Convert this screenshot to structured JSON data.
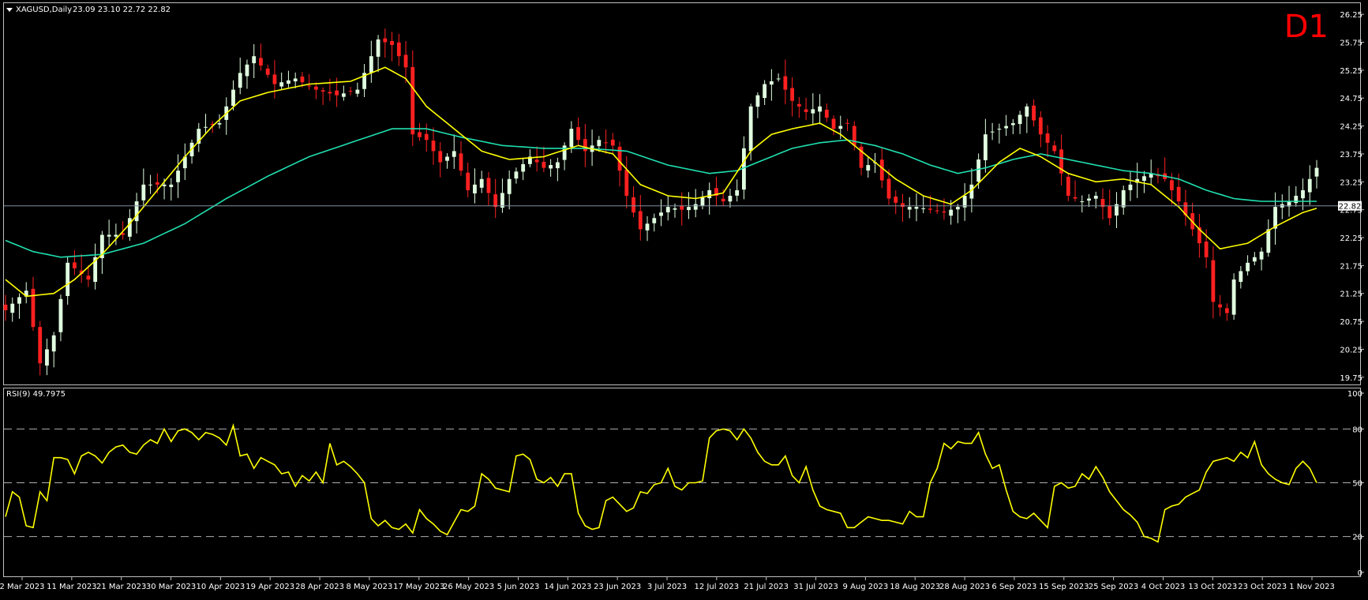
{
  "header": {
    "symbol_title": "XAGUSD,Daily",
    "ohlc_text": "23.09 23.10 22.72 22.82",
    "timeframe_badge": "D1"
  },
  "colors": {
    "background": "#000000",
    "candle_up": "#E0FFE0",
    "candle_down": "#FF2020",
    "ma_fast": "#FFFF00",
    "ma_slow": "#20E0B0",
    "rsi_line": "#FFFF00",
    "badge": "#FF0000",
    "axis_text": "#FFFFFF",
    "frame": "#C0C0C0",
    "level_line": "#8090A0"
  },
  "chart_data": [
    {
      "type": "candlestick",
      "title": "XAGUSD,Daily",
      "price_axis_ticks": [
        "26.25",
        "25.75",
        "25.25",
        "24.75",
        "24.25",
        "23.75",
        "23.25",
        "22.75",
        "22.25",
        "21.75",
        "21.25",
        "20.75",
        "20.25",
        "19.75"
      ],
      "ylim": [
        19.62,
        26.45
      ],
      "current_price_label": "22.82",
      "current_price": 22.82,
      "x_tick_labels": [
        "2 Mar 2023",
        "11 Mar 2023",
        "21 Mar 2023",
        "30 Mar 2023",
        "10 Apr 2023",
        "19 Apr 2023",
        "28 Apr 2023",
        "8 May 2023",
        "17 May 2023",
        "26 May 2023",
        "5 Jun 2023",
        "14 Jun 2023",
        "23 Jun 2023",
        "3 Jul 2023",
        "12 Jul 2023",
        "21 Jul 2023",
        "31 Jul 2023",
        "9 Aug 2023",
        "18 Aug 2023",
        "28 Aug 2023",
        "6 Sep 2023",
        "15 Sep 2023",
        "25 Sep 2023",
        "4 Oct 2023",
        "13 Oct 2023",
        "23 Oct 2023",
        "1 Nov 2023"
      ],
      "close_anchors": [
        [
          0,
          20.95
        ],
        [
          3,
          21.3
        ],
        [
          5,
          20.0
        ],
        [
          7,
          20.5
        ],
        [
          9,
          21.8
        ],
        [
          12,
          21.5
        ],
        [
          14,
          22.3
        ],
        [
          17,
          22.3
        ],
        [
          20,
          23.2
        ],
        [
          24,
          23.2
        ],
        [
          28,
          24.2
        ],
        [
          31,
          24.3
        ],
        [
          34,
          25.2
        ],
        [
          36,
          25.5
        ],
        [
          39,
          25.0
        ],
        [
          42,
          25.1
        ],
        [
          45,
          24.9
        ],
        [
          48,
          24.8
        ],
        [
          51,
          24.9
        ],
        [
          54,
          25.8
        ],
        [
          56,
          25.7
        ],
        [
          58,
          25.3
        ],
        [
          59,
          24.1
        ],
        [
          61,
          24.0
        ],
        [
          63,
          23.6
        ],
        [
          65,
          23.8
        ],
        [
          67,
          23.1
        ],
        [
          69,
          23.3
        ],
        [
          71,
          22.8
        ],
        [
          73,
          23.3
        ],
        [
          76,
          23.7
        ],
        [
          78,
          23.5
        ],
        [
          80,
          23.6
        ],
        [
          82,
          24.2
        ],
        [
          84,
          23.8
        ],
        [
          86,
          24.0
        ],
        [
          88,
          23.9
        ],
        [
          90,
          23.0
        ],
        [
          92,
          22.4
        ],
        [
          94,
          22.6
        ],
        [
          96,
          22.8
        ],
        [
          98,
          22.75
        ],
        [
          100,
          22.85
        ],
        [
          102,
          23.1
        ],
        [
          104,
          22.9
        ],
        [
          106,
          23.1
        ],
        [
          108,
          24.6
        ],
        [
          110,
          25.0
        ],
        [
          112,
          25.1
        ],
        [
          114,
          24.7
        ],
        [
          116,
          24.5
        ],
        [
          118,
          24.6
        ],
        [
          120,
          24.2
        ],
        [
          122,
          24.3
        ],
        [
          124,
          23.5
        ],
        [
          126,
          23.6
        ],
        [
          128,
          22.95
        ],
        [
          130,
          22.8
        ],
        [
          132,
          22.8
        ],
        [
          134,
          22.75
        ],
        [
          136,
          22.7
        ],
        [
          138,
          22.8
        ],
        [
          140,
          23.2
        ],
        [
          142,
          24.1
        ],
        [
          144,
          24.2
        ],
        [
          146,
          24.3
        ],
        [
          148,
          24.6
        ],
        [
          150,
          24.1
        ],
        [
          152,
          23.8
        ],
        [
          154,
          23.0
        ],
        [
          156,
          22.9
        ],
        [
          158,
          23.0
        ],
        [
          160,
          22.6
        ],
        [
          162,
          23.1
        ],
        [
          164,
          23.3
        ],
        [
          166,
          23.4
        ],
        [
          168,
          23.3
        ],
        [
          170,
          22.9
        ],
        [
          172,
          22.4
        ],
        [
          174,
          21.9
        ],
        [
          175,
          21.1
        ],
        [
          177,
          20.9
        ],
        [
          178,
          21.5
        ],
        [
          180,
          21.8
        ],
        [
          182,
          22.0
        ],
        [
          184,
          22.8
        ],
        [
          186,
          22.9
        ],
        [
          188,
          23.1
        ],
        [
          190,
          23.5
        ],
        [
          192,
          23.2
        ],
        [
          194,
          22.9
        ],
        [
          196,
          22.8
        ],
        [
          198,
          23.2
        ],
        [
          200,
          23.0
        ],
        [
          201,
          22.82
        ]
      ],
      "fast_ma_anchors": [
        [
          0,
          21.5
        ],
        [
          3,
          21.2
        ],
        [
          7,
          21.25
        ],
        [
          10,
          21.5
        ],
        [
          14,
          21.95
        ],
        [
          18,
          22.5
        ],
        [
          22,
          23.1
        ],
        [
          26,
          23.7
        ],
        [
          30,
          24.25
        ],
        [
          34,
          24.7
        ],
        [
          38,
          24.85
        ],
        [
          44,
          25.0
        ],
        [
          50,
          25.05
        ],
        [
          55,
          25.3
        ],
        [
          58,
          25.1
        ],
        [
          61,
          24.6
        ],
        [
          65,
          24.2
        ],
        [
          69,
          23.8
        ],
        [
          73,
          23.65
        ],
        [
          78,
          23.7
        ],
        [
          83,
          23.9
        ],
        [
          88,
          23.75
        ],
        [
          92,
          23.2
        ],
        [
          96,
          23.0
        ],
        [
          100,
          22.95
        ],
        [
          104,
          23.05
        ],
        [
          108,
          23.8
        ],
        [
          111,
          24.1
        ],
        [
          114,
          24.2
        ],
        [
          118,
          24.3
        ],
        [
          121,
          24.1
        ],
        [
          125,
          23.7
        ],
        [
          129,
          23.3
        ],
        [
          133,
          23.0
        ],
        [
          137,
          22.85
        ],
        [
          140,
          23.1
        ],
        [
          144,
          23.6
        ],
        [
          147,
          23.85
        ],
        [
          150,
          23.7
        ],
        [
          154,
          23.4
        ],
        [
          158,
          23.25
        ],
        [
          162,
          23.3
        ],
        [
          166,
          23.2
        ],
        [
          170,
          22.8
        ],
        [
          173,
          22.4
        ],
        [
          176,
          22.05
        ],
        [
          180,
          22.15
        ],
        [
          184,
          22.45
        ],
        [
          188,
          22.7
        ],
        [
          192,
          22.85
        ],
        [
          196,
          22.9
        ],
        [
          200,
          22.95
        ],
        [
          201,
          22.9
        ]
      ],
      "slow_ma_anchors": [
        [
          0,
          22.2
        ],
        [
          4,
          22.0
        ],
        [
          8,
          21.9
        ],
        [
          14,
          21.95
        ],
        [
          20,
          22.15
        ],
        [
          26,
          22.5
        ],
        [
          32,
          22.95
        ],
        [
          38,
          23.35
        ],
        [
          44,
          23.7
        ],
        [
          50,
          23.95
        ],
        [
          56,
          24.2
        ],
        [
          61,
          24.2
        ],
        [
          66,
          24.05
        ],
        [
          72,
          23.9
        ],
        [
          78,
          23.85
        ],
        [
          84,
          23.85
        ],
        [
          90,
          23.8
        ],
        [
          96,
          23.55
        ],
        [
          102,
          23.4
        ],
        [
          106,
          23.45
        ],
        [
          110,
          23.65
        ],
        [
          114,
          23.85
        ],
        [
          118,
          23.95
        ],
        [
          122,
          24.0
        ],
        [
          126,
          23.9
        ],
        [
          130,
          23.75
        ],
        [
          134,
          23.55
        ],
        [
          138,
          23.4
        ],
        [
          142,
          23.5
        ],
        [
          146,
          23.65
        ],
        [
          150,
          23.75
        ],
        [
          154,
          23.65
        ],
        [
          158,
          23.55
        ],
        [
          162,
          23.45
        ],
        [
          166,
          23.4
        ],
        [
          170,
          23.3
        ],
        [
          174,
          23.1
        ],
        [
          178,
          22.95
        ],
        [
          182,
          22.9
        ],
        [
          186,
          22.9
        ],
        [
          190,
          22.9
        ],
        [
          196,
          22.85
        ],
        [
          201,
          22.85
        ]
      ]
    },
    {
      "type": "line",
      "title": "RSI(9) 49.7975",
      "ylim": [
        0,
        100
      ],
      "y_tick_labels": [
        "100",
        "80",
        "50",
        "20",
        "0"
      ],
      "levels": [
        80,
        50,
        20
      ],
      "values": [
        31,
        45,
        42,
        26,
        25,
        45,
        40,
        64,
        64,
        63,
        55,
        65,
        67,
        65,
        61,
        67,
        70,
        71,
        67,
        66,
        71,
        74,
        72,
        80,
        73,
        79,
        80,
        78,
        74,
        78,
        77,
        75,
        71,
        82,
        65,
        66,
        58,
        64,
        62,
        60,
        55,
        56,
        48,
        54,
        51,
        56,
        50,
        72,
        60,
        62,
        59,
        55,
        50,
        30,
        26,
        29,
        25,
        24,
        27,
        22,
        35,
        30,
        27,
        23,
        21,
        28,
        35,
        34,
        37,
        55,
        52,
        47,
        46,
        45,
        65,
        66,
        63,
        52,
        50,
        53,
        48,
        55,
        55,
        33,
        26,
        24,
        25,
        40,
        42,
        38,
        34,
        36,
        45,
        44,
        49,
        50,
        58,
        48,
        46,
        50,
        50,
        51,
        75,
        79,
        80,
        79,
        74,
        80,
        75,
        67,
        62,
        60,
        60,
        65,
        54,
        50,
        59,
        46,
        37,
        35,
        34,
        33,
        25,
        25,
        28,
        31,
        30,
        29,
        29,
        28,
        27,
        34,
        31,
        31,
        50,
        58,
        72,
        69,
        73,
        72,
        72,
        78,
        66,
        58,
        60,
        46,
        34,
        31,
        30,
        33,
        29,
        25,
        48,
        50,
        47,
        48,
        55,
        52,
        59,
        53,
        45,
        40,
        35,
        32,
        28,
        20,
        19,
        17,
        35,
        37,
        38,
        42,
        44,
        46,
        56,
        62,
        63,
        64,
        62,
        67,
        64,
        73,
        60,
        55,
        52,
        50,
        49,
        58,
        62,
        58,
        50
      ]
    }
  ]
}
